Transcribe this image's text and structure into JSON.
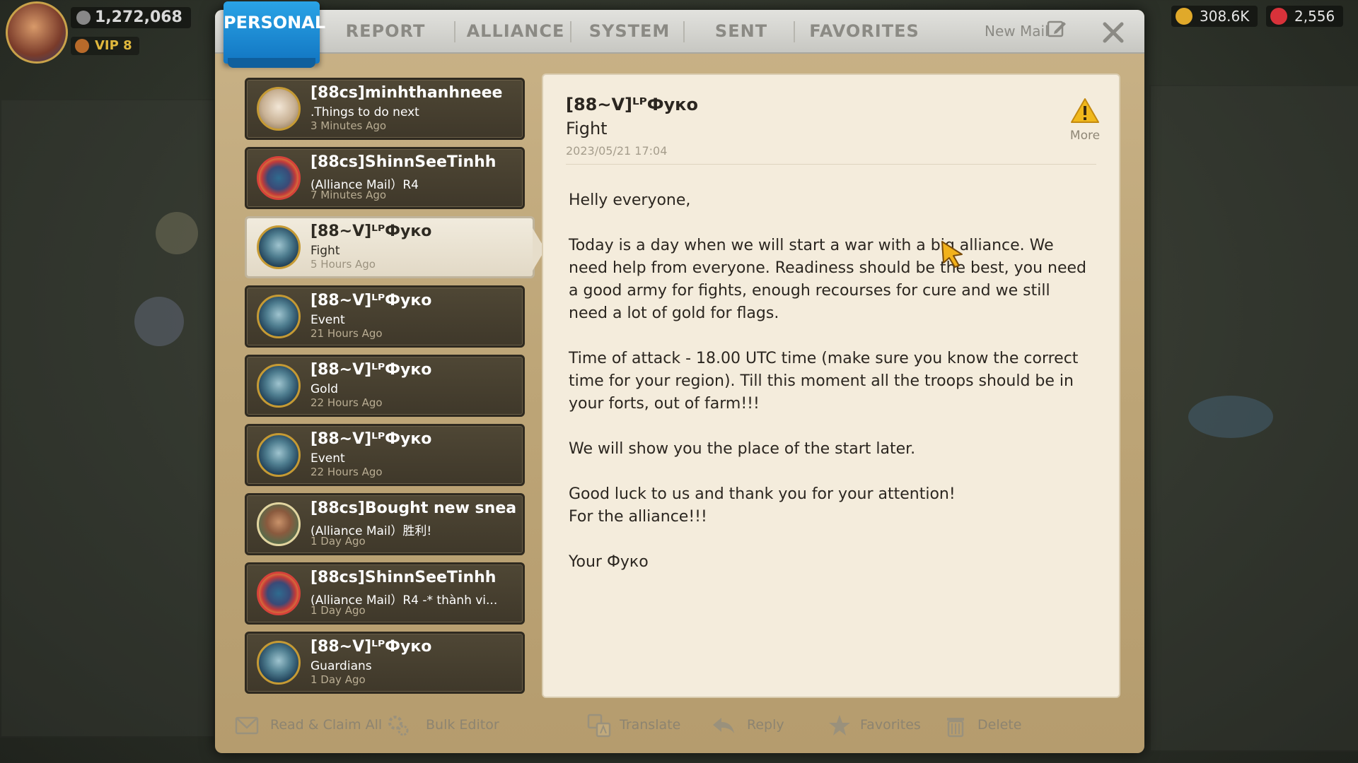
{
  "hud": {
    "power": "1,272,068",
    "vip": "VIP 8",
    "resources": [
      {
        "name": "gold",
        "value": "308.6K",
        "color": "#e0a92a"
      },
      {
        "name": "gems",
        "value": "2,556",
        "color": "#d8323a"
      }
    ]
  },
  "tabs": {
    "active": "PERSONAL",
    "items": [
      "REPORT",
      "ALLIANCE",
      "SYSTEM",
      "SENT",
      "FAVORITES"
    ],
    "new_mail": "New Mail"
  },
  "mails": [
    {
      "sender": "[88cs]minhthanhneee",
      "subject": ".Things to do next",
      "time": "3 Minutes Ago",
      "avatar": "hamster-avatar"
    },
    {
      "sender": "[88cs]ShinnSeeTinhh",
      "subject": "(Alliance Mail）R4",
      "time": "7 Minutes Ago",
      "avatar": "flower-avatar"
    },
    {
      "sender": "[88~V]ᴸᴾФуко",
      "subject": "Fight",
      "time": "5 Hours Ago",
      "avatar": "girl-avatar"
    },
    {
      "sender": "[88~V]ᴸᴾФуко",
      "subject": "Event",
      "time": "21 Hours Ago",
      "avatar": "girl-avatar"
    },
    {
      "sender": "[88~V]ᴸᴾФуко",
      "subject": "Gold",
      "time": "22 Hours Ago",
      "avatar": "girl-avatar"
    },
    {
      "sender": "[88~V]ᴸᴾФуко",
      "subject": "Event",
      "time": "22 Hours Ago",
      "avatar": "girl-avatar"
    },
    {
      "sender": "[88cs]Bought new snea",
      "subject": "(Alliance Mail）胜利!",
      "time": "1 Day Ago",
      "avatar": "man-avatar"
    },
    {
      "sender": "[88cs]ShinnSeeTinhh",
      "subject": "(Alliance Mail）R4 -* thành vi...",
      "time": "1 Day Ago",
      "avatar": "flower-avatar"
    },
    {
      "sender": "[88~V]ᴸᴾФуко",
      "subject": "Guardians",
      "time": "1 Day Ago",
      "avatar": "girl-avatar"
    }
  ],
  "reader": {
    "from": "[88~V]ᴸᴾФуко",
    "subject": "Fight",
    "date": "2023/05/21 17:04",
    "more_label": "More",
    "body": [
      "Helly everyone,",
      "Today is a day when we will start a war with a big alliance. We need help from everyone. Readiness should be the best, you need a good army for fights, enough recourses for cure and we still need a lot of gold for flags.",
      "Time of attack - 18.00 UTC time (make sure you know the correct time for your region). Till this moment all the troops should be in your forts, out of farm!!!",
      "We will show you the place of the start later.",
      "Good luck to us and thank you for your attention!\nFor the alliance!!!",
      "Your Фуко"
    ]
  },
  "actions": {
    "read_claim_all": "Read & Claim All",
    "bulk_editor": "Bulk Editor",
    "translate": "Translate",
    "reply": "Reply",
    "favorites": "Favorites",
    "delete": "Delete"
  },
  "colors": {
    "active_tab": "#1b8fd6",
    "panel": "#c2aa7c",
    "reader_bg": "#f4ecdc"
  }
}
